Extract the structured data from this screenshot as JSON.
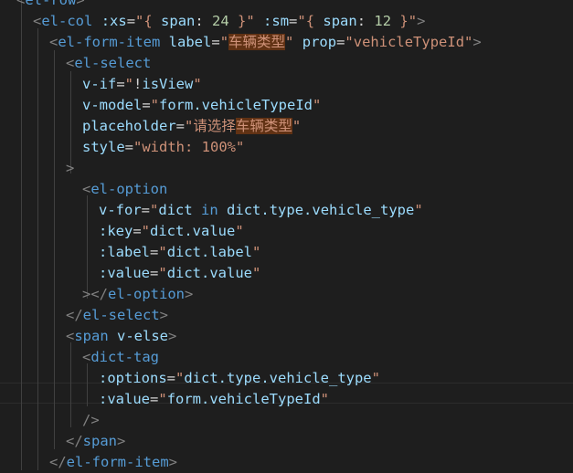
{
  "editor": {
    "theme_colors": {
      "background": "#1e1e1e",
      "tag": "#569cd6",
      "attribute": "#9cdcfe",
      "string": "#ce9178",
      "number": "#b5cea8",
      "punctuation": "#808080",
      "search_highlight": "#613214"
    },
    "lines": [
      [
        [
          "bracket",
          "<"
        ],
        [
          "tag",
          "el-row"
        ],
        [
          "bracket",
          ">"
        ]
      ],
      [
        [
          "bracket",
          "<"
        ],
        [
          "tag",
          "el-col"
        ],
        [
          "op",
          " "
        ],
        [
          "attr",
          ":xs"
        ],
        [
          "eq",
          "="
        ],
        [
          "str",
          "\"{ "
        ],
        [
          "var",
          "span"
        ],
        [
          "op",
          ": "
        ],
        [
          "num",
          "24"
        ],
        [
          "str",
          " }\""
        ],
        [
          "op",
          " "
        ],
        [
          "attr",
          ":sm"
        ],
        [
          "eq",
          "="
        ],
        [
          "str",
          "\"{ "
        ],
        [
          "var",
          "span"
        ],
        [
          "op",
          ": "
        ],
        [
          "num",
          "12"
        ],
        [
          "str",
          " }\""
        ],
        [
          "bracket",
          ">"
        ]
      ],
      [
        [
          "bracket",
          "<"
        ],
        [
          "tag",
          "el-form-item"
        ],
        [
          "op",
          " "
        ],
        [
          "attr",
          "label"
        ],
        [
          "eq",
          "="
        ],
        [
          "str",
          "\""
        ],
        [
          "hl",
          "车辆类型"
        ],
        [
          "str",
          "\""
        ],
        [
          "op",
          " "
        ],
        [
          "attr",
          "prop"
        ],
        [
          "eq",
          "="
        ],
        [
          "str",
          "\"vehicleTypeId\""
        ],
        [
          "bracket",
          ">"
        ]
      ],
      [
        [
          "bracket",
          "<"
        ],
        [
          "tag",
          "el-select"
        ]
      ],
      [
        [
          "attr",
          "v-if"
        ],
        [
          "eq",
          "="
        ],
        [
          "str",
          "\""
        ],
        [
          "op",
          "!"
        ],
        [
          "var",
          "isView"
        ],
        [
          "str",
          "\""
        ]
      ],
      [
        [
          "attr",
          "v-model"
        ],
        [
          "eq",
          "="
        ],
        [
          "str",
          "\""
        ],
        [
          "var",
          "form.vehicleTypeId"
        ],
        [
          "str",
          "\""
        ]
      ],
      [
        [
          "attr",
          "placeholder"
        ],
        [
          "eq",
          "="
        ],
        [
          "str",
          "\"请选择"
        ],
        [
          "hl",
          "车辆类型"
        ],
        [
          "str",
          "\""
        ]
      ],
      [
        [
          "attr",
          "style"
        ],
        [
          "eq",
          "="
        ],
        [
          "str",
          "\"width: 100%\""
        ]
      ],
      [
        [
          "bracket",
          ">"
        ]
      ],
      [
        [
          "bracket",
          "<"
        ],
        [
          "tag",
          "el-option"
        ]
      ],
      [
        [
          "attr",
          "v-for"
        ],
        [
          "eq",
          "="
        ],
        [
          "str",
          "\""
        ],
        [
          "var",
          "dict"
        ],
        [
          "op",
          " "
        ],
        [
          "kw",
          "in"
        ],
        [
          "op",
          " "
        ],
        [
          "var",
          "dict.type.vehicle_type"
        ],
        [
          "str",
          "\""
        ]
      ],
      [
        [
          "attr",
          ":key"
        ],
        [
          "eq",
          "="
        ],
        [
          "str",
          "\""
        ],
        [
          "var",
          "dict.value"
        ],
        [
          "str",
          "\""
        ]
      ],
      [
        [
          "attr",
          ":label"
        ],
        [
          "eq",
          "="
        ],
        [
          "str",
          "\""
        ],
        [
          "var",
          "dict.label"
        ],
        [
          "str",
          "\""
        ]
      ],
      [
        [
          "attr",
          ":value"
        ],
        [
          "eq",
          "="
        ],
        [
          "str",
          "\""
        ],
        [
          "var",
          "dict.value"
        ],
        [
          "str",
          "\""
        ]
      ],
      [
        [
          "bracket",
          "></"
        ],
        [
          "tag",
          "el-option"
        ],
        [
          "bracket",
          ">"
        ]
      ],
      [
        [
          "bracket",
          "</"
        ],
        [
          "tag",
          "el-select"
        ],
        [
          "bracket",
          ">"
        ]
      ],
      [
        [
          "bracket",
          "<"
        ],
        [
          "tag",
          "span"
        ],
        [
          "op",
          " "
        ],
        [
          "attr",
          "v-else"
        ],
        [
          "bracket",
          ">"
        ]
      ],
      [
        [
          "bracket",
          "<"
        ],
        [
          "tag",
          "dict-tag"
        ]
      ],
      [
        [
          "attr",
          ":options"
        ],
        [
          "eq",
          "="
        ],
        [
          "str",
          "\""
        ],
        [
          "var",
          "dict.type.vehicle_type"
        ],
        [
          "str",
          "\""
        ]
      ],
      [
        [
          "attr",
          ":value"
        ],
        [
          "eq",
          "="
        ],
        [
          "str",
          "\""
        ],
        [
          "var",
          "form.vehicleTypeId"
        ],
        [
          "str",
          "\""
        ]
      ],
      [
        [
          "bracket",
          "/>"
        ]
      ],
      [
        [
          "bracket",
          "</"
        ],
        [
          "tag",
          "span"
        ],
        [
          "bracket",
          ">"
        ]
      ],
      [
        [
          "bracket",
          "</"
        ],
        [
          "tag",
          "el-form-item"
        ],
        [
          "bracket",
          ">"
        ]
      ]
    ]
  }
}
